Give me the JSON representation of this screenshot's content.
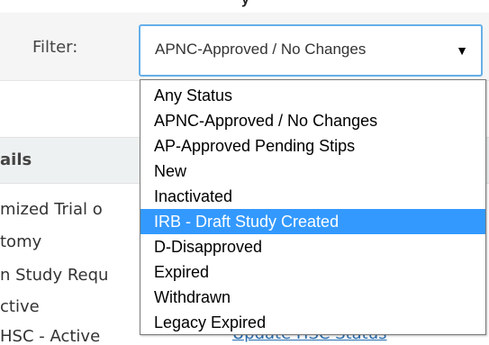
{
  "filter": {
    "label": "Filter:",
    "selected_value": "APNC-Approved / No Changes",
    "arrow": "▼",
    "options": [
      {
        "label": "Any Status",
        "highlighted": false
      },
      {
        "label": "APNC-Approved / No Changes",
        "highlighted": false
      },
      {
        "label": "AP-Approved Pending Stips",
        "highlighted": false
      },
      {
        "label": "New",
        "highlighted": false
      },
      {
        "label": "Inactivated",
        "highlighted": false
      },
      {
        "label": "IRB - Draft Study Created",
        "highlighted": true
      },
      {
        "label": "D-Disapproved",
        "highlighted": false
      },
      {
        "label": "Expired",
        "highlighted": false
      },
      {
        "label": "Withdrawn",
        "highlighted": false
      },
      {
        "label": "Legacy Expired",
        "highlighted": false
      }
    ]
  },
  "background": {
    "top_heading": "y",
    "details_header": "ails",
    "lines": [
      "mized Trial o",
      "tomy",
      "n Study Requ",
      "ctive",
      "HSC - Active"
    ],
    "update_link": "Update HSC Status"
  },
  "colors": {
    "select_border": "#66afe9",
    "highlight": "#3399ff"
  }
}
